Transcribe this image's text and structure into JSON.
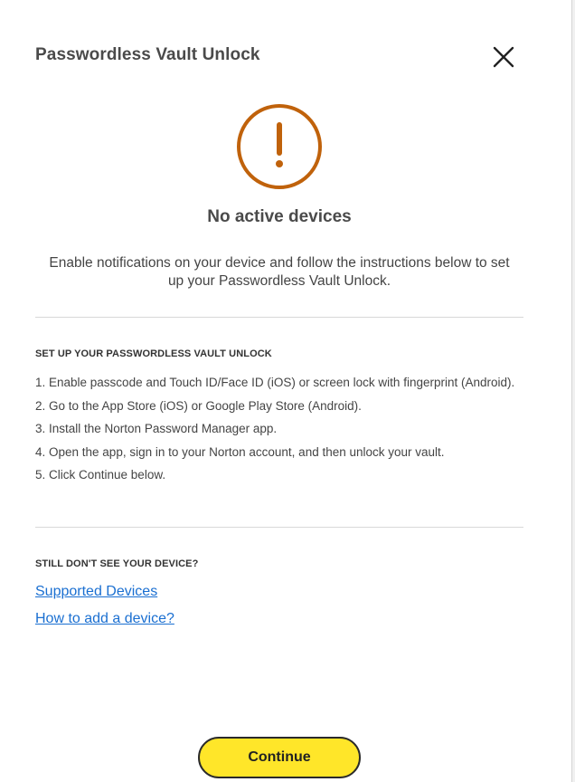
{
  "dialog": {
    "title": "Passwordless Vault Unlock",
    "close_icon": "close-icon"
  },
  "status": {
    "icon": "exclamation-circle-icon",
    "icon_color": "#c0620b",
    "headline": "No active devices",
    "description": "Enable notifications on your device and follow the instructions below to set up your Passwordless Vault Unlock."
  },
  "setup": {
    "heading": "SET UP YOUR PASSWORDLESS VAULT UNLOCK",
    "steps": [
      "1. Enable passcode and Touch ID/Face ID (iOS) or screen lock with fingerprint (Android).",
      "2. Go to the App Store (iOS) or Google Play Store (Android).",
      "3. Install the Norton Password Manager app.",
      "4. Open the app, sign in to your Norton account, and then unlock your vault.",
      "5. Click Continue below."
    ]
  },
  "help": {
    "heading": "STILL DON'T SEE YOUR DEVICE?",
    "links": [
      "Supported Devices",
      "How to add a device?"
    ],
    "link_color": "#1a6fd1"
  },
  "footer": {
    "continue_label": "Continue",
    "button_color": "#ffe629"
  }
}
